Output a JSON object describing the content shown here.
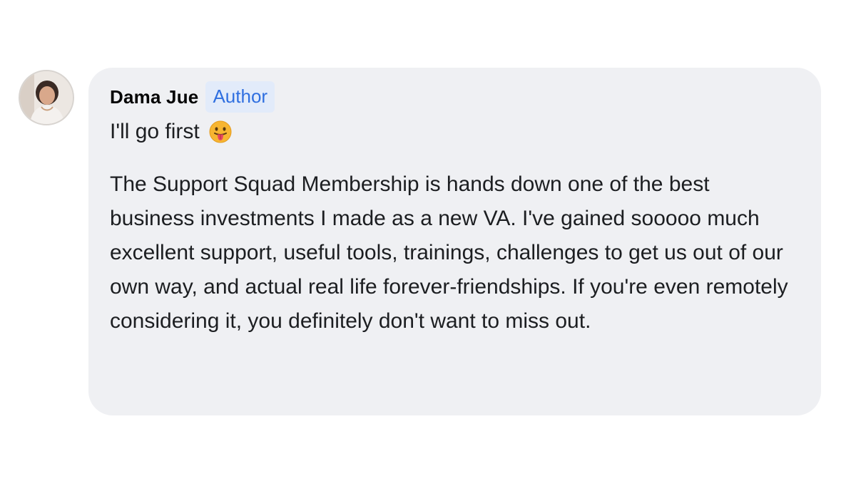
{
  "comment": {
    "author_name": "Dama Jue",
    "author_badge": "Author",
    "first_line": "I'll go first",
    "first_line_emoji": "face-with-tongue-icon",
    "body": "The Support Squad Membership is hands down one of the best business investments I made as a new VA. I've gained sooooo much excellent support, useful tools, trainings, challenges to get us out of our own way, and actual real life forever-friendships. If you're even remotely considering it, you definitely don't want to miss out."
  },
  "colors": {
    "bubble_background": "#eff0f3",
    "badge_background": "#e2ebfa",
    "badge_text": "#2f6fe0"
  }
}
